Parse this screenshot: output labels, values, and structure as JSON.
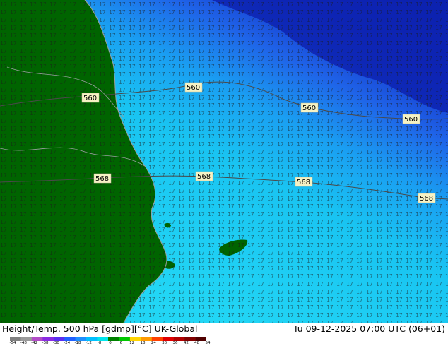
{
  "map": {
    "contour_labels": [
      "560",
      "560",
      "560",
      "560",
      "568",
      "568",
      "568",
      "568"
    ]
  },
  "footer": {
    "title": "Height/Temp. 500 hPa [gdmp][°C] UK-Global",
    "valid_time": "Tu 09-12-2025 07:00 UTC (06+01)"
  },
  "colorbar": {
    "ticks": [
      "-54",
      "-48",
      "-42",
      "-38",
      "-30",
      "-24",
      "-18",
      "-12",
      "-8",
      "0",
      "6",
      "12",
      "18",
      "24",
      "30",
      "36",
      "42",
      "48",
      "54"
    ],
    "colors": [
      "#808080",
      "#9a9a9a",
      "#b24cc7",
      "#8a2be2",
      "#5a2ef0",
      "#2060ff",
      "#1e90ff",
      "#00bfff",
      "#00e5ee",
      "#008000",
      "#00c800",
      "#ffd400",
      "#ff9a00",
      "#ff4000",
      "#e00000",
      "#b00000",
      "#800000",
      "#500000"
    ]
  },
  "colors": {
    "land": "#006400",
    "sea_cold": "#0a2ab8",
    "sea_mid": "#2a7df0",
    "sea_warm": "#1ec8f0",
    "number_glyph": "#1a1a1a"
  }
}
